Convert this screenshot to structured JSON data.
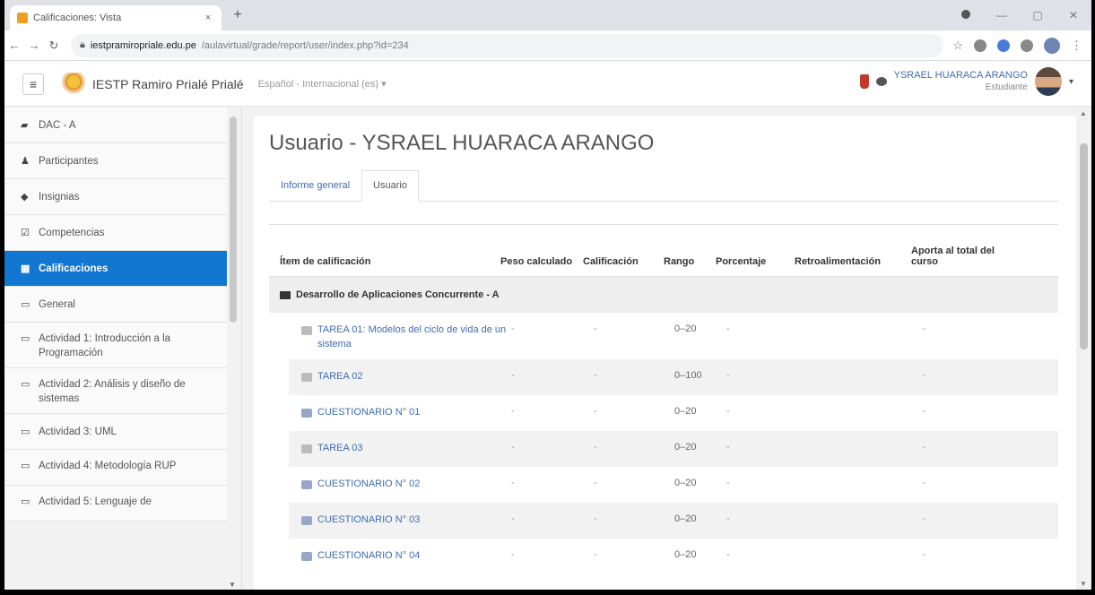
{
  "browser": {
    "tab_title": "Calificaciones: Vista",
    "tab_close": "×",
    "new_tab": "+",
    "url_host": "iestpramiropriale.edu.pe",
    "url_path": "/aulavirtual/grade/report/user/index.php?id=234",
    "win_min": "—",
    "win_max": "▢",
    "win_close": "✕"
  },
  "navbar": {
    "menu_icon": "≡",
    "site_name": "IESTP Ramiro Prialé Prialé",
    "language": "Español - Internacional (es) ▾",
    "user_name": "YSRAEL HUARACA ARANGO",
    "user_role": "Estudiante",
    "caret": "▾"
  },
  "drawer": {
    "items": [
      {
        "icon": "graduation-cap-icon",
        "glyph": "▰",
        "label": "DAC - A"
      },
      {
        "icon": "users-icon",
        "glyph": "♟",
        "label": "Participantes"
      },
      {
        "icon": "shield-icon",
        "glyph": "◆",
        "label": "Insignias"
      },
      {
        "icon": "checklist-icon",
        "glyph": "☑",
        "label": "Competencias"
      },
      {
        "icon": "table-icon",
        "glyph": "▦",
        "label": "Calificaciones",
        "active": true
      },
      {
        "icon": "folder-icon",
        "glyph": "▭",
        "label": "General"
      },
      {
        "icon": "folder-icon",
        "glyph": "▭",
        "label": "Actividad 1: Introducción a la Programación"
      },
      {
        "icon": "folder-icon",
        "glyph": "▭",
        "label": "Actividad 2: Análisis y diseño de sistemas"
      },
      {
        "icon": "folder-icon",
        "glyph": "▭",
        "label": "Actividad 3: UML"
      },
      {
        "icon": "folder-icon",
        "glyph": "▭",
        "label": "Actividad 4: Metodología RUP"
      },
      {
        "icon": "folder-icon",
        "glyph": "▭",
        "label": "Actividad 5: Lenguaje de"
      }
    ]
  },
  "main": {
    "title": "Usuario - YSRAEL HUARACA ARANGO",
    "tabs": [
      "Informe general",
      "Usuario"
    ],
    "columns": [
      "Ítem de calificación",
      "Peso calculado",
      "Calificación",
      "Rango",
      "Porcentaje",
      "Retroalimentación",
      "Aporta al total del curso"
    ],
    "category": "Desarrollo de Aplicaciones Concurrente - A",
    "rows": [
      {
        "type": "assign",
        "item": "TAREA 01: Modelos del ciclo de vida de un sistema",
        "peso": "-",
        "calificacion": "-",
        "rango": "0–20",
        "porcentaje": "-",
        "retro": "",
        "aporta": "-"
      },
      {
        "type": "assign",
        "item": "TAREA 02",
        "peso": "-",
        "calificacion": "-",
        "rango": "0–100",
        "porcentaje": "-",
        "retro": "",
        "aporta": "-"
      },
      {
        "type": "quiz",
        "item": "CUESTIONARIO N° 01",
        "peso": "-",
        "calificacion": "-",
        "rango": "0–20",
        "porcentaje": "-",
        "retro": "",
        "aporta": "-"
      },
      {
        "type": "assign",
        "item": "TAREA 03",
        "peso": "-",
        "calificacion": "-",
        "rango": "0–20",
        "porcentaje": "-",
        "retro": "",
        "aporta": "-"
      },
      {
        "type": "quiz",
        "item": "CUESTIONARIO N° 02",
        "peso": "-",
        "calificacion": "-",
        "rango": "0–20",
        "porcentaje": "-",
        "retro": "",
        "aporta": "-"
      },
      {
        "type": "quiz",
        "item": "CUESTIONARIO N° 03",
        "peso": "-",
        "calificacion": "-",
        "rango": "0–20",
        "porcentaje": "-",
        "retro": "",
        "aporta": "-"
      },
      {
        "type": "quiz",
        "item": "CUESTIONARIO N° 04",
        "peso": "-",
        "calificacion": "-",
        "rango": "0–20",
        "porcentaje": "-",
        "retro": "",
        "aporta": "-"
      }
    ]
  },
  "colors": {
    "accent": "#1177d1",
    "link": "#3f6db3",
    "drawer_bg": "#f2f2f2"
  }
}
